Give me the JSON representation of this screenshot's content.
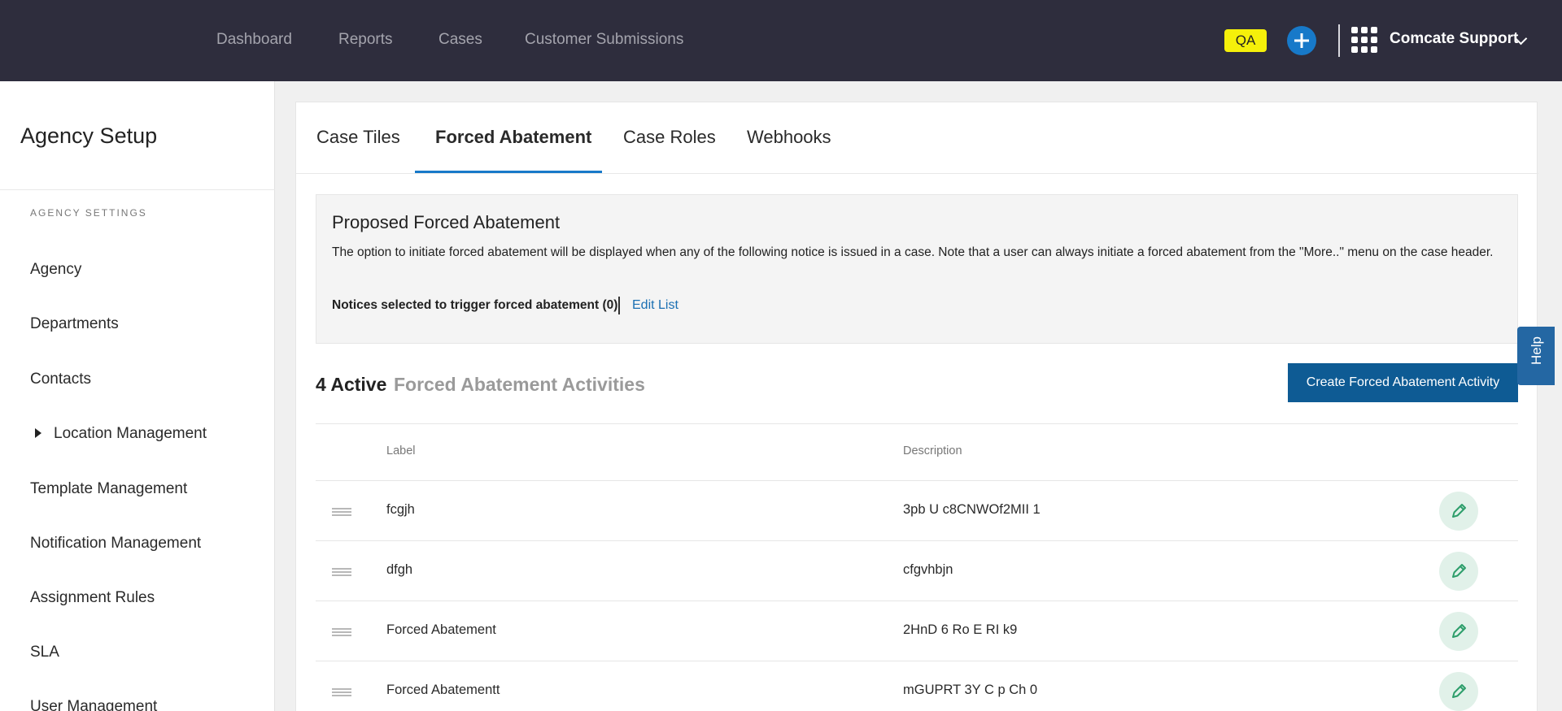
{
  "topnav": {
    "items": [
      "Dashboard",
      "Reports",
      "Cases",
      "Customer Submissions"
    ],
    "env_badge": "QA",
    "account_name": "Comcate Support"
  },
  "sidebar": {
    "title": "Agency Setup",
    "section_label": "AGENCY SETTINGS",
    "items": [
      "Agency",
      "Departments",
      "Contacts",
      "Location Management",
      "Template Management",
      "Notification Management",
      "Assignment Rules",
      "SLA",
      "User Management"
    ]
  },
  "tabs": [
    "Case Tiles",
    "Forced Abatement",
    "Case Roles",
    "Webhooks"
  ],
  "proposed": {
    "title": "Proposed Forced Abatement",
    "description": "The option to initiate forced abatement will be displayed when any of the following notice is issued in a case. Note that a user can always initiate a forced abatement from the \"More..\" menu on the case header.",
    "notices_text": "Notices selected to trigger forced abatement (0)",
    "edit_list": "Edit List"
  },
  "activities": {
    "count_text": "4 Active",
    "label": "Forced Abatement Activities",
    "create_button": "Create Forced Abatement Activity",
    "columns": {
      "label": "Label",
      "description": "Description"
    },
    "rows": [
      {
        "label": "fcgjh",
        "description": "3pb U c8CNWOf2MII 1"
      },
      {
        "label": "dfgh",
        "description": "cfgvhbjn"
      },
      {
        "label": "Forced Abatement",
        "description": "2HnD 6 Ro E RI k9"
      },
      {
        "label": "Forced Abatementt",
        "description": "mGUPRT 3Y C p Ch 0"
      }
    ]
  },
  "help": {
    "label": "Help"
  },
  "colors": {
    "topbar": "#2e2d3d",
    "accent": "#1779c9",
    "primary_button": "#0e5b94",
    "edit_icon": "#2e9e6b",
    "badge": "#f5f00a"
  }
}
